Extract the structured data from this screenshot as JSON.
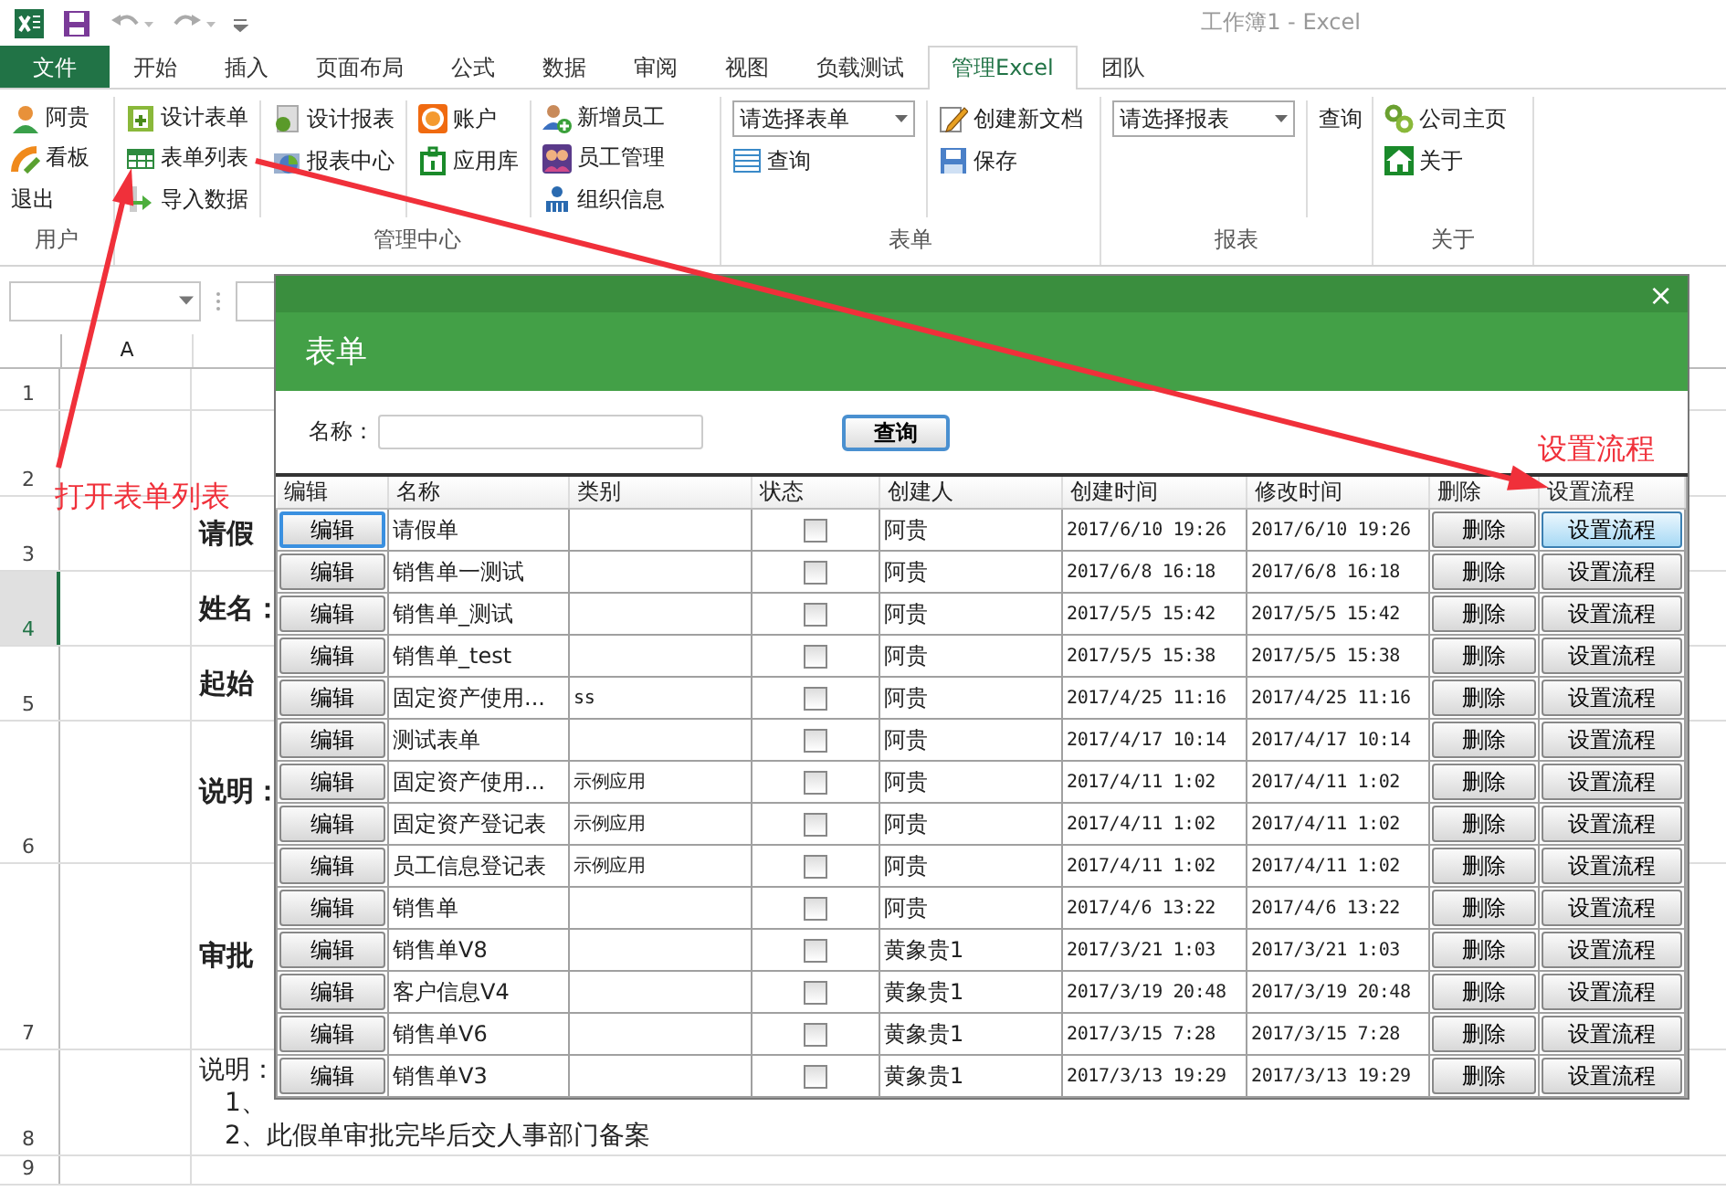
{
  "title_bar": {
    "title": "工作簿1 - Excel"
  },
  "tabs": [
    {
      "label": "文件",
      "kind": "file",
      "selected": false
    },
    {
      "label": "开始",
      "kind": "tab",
      "selected": false
    },
    {
      "label": "插入",
      "kind": "tab",
      "selected": false
    },
    {
      "label": "页面布局",
      "kind": "tab",
      "selected": false
    },
    {
      "label": "公式",
      "kind": "tab",
      "selected": false
    },
    {
      "label": "数据",
      "kind": "tab",
      "selected": false
    },
    {
      "label": "审阅",
      "kind": "tab",
      "selected": false
    },
    {
      "label": "视图",
      "kind": "tab",
      "selected": false
    },
    {
      "label": "负载测试",
      "kind": "tab",
      "selected": false
    },
    {
      "label": "管理Excel",
      "kind": "tab",
      "selected": true
    },
    {
      "label": "团队",
      "kind": "tab",
      "selected": false
    }
  ],
  "ribbon": {
    "groups": [
      {
        "label": "用户",
        "columns": [
          {
            "items": [
              {
                "kind": "button",
                "label": "阿贵"
              },
              {
                "kind": "button",
                "label": "看板"
              },
              {
                "kind": "text",
                "label": "退出"
              }
            ]
          }
        ]
      },
      {
        "label": "管理中心",
        "columns": [
          {
            "items": [
              {
                "kind": "button",
                "label": "设计表单"
              },
              {
                "kind": "button",
                "label": "表单列表"
              },
              {
                "kind": "button",
                "label": "导入数据"
              }
            ]
          },
          {
            "items": [
              {
                "kind": "button",
                "label": "设计报表"
              },
              {
                "kind": "button",
                "label": "报表中心"
              }
            ]
          },
          {
            "items": [
              {
                "kind": "button",
                "label": "账户"
              },
              {
                "kind": "button",
                "label": "应用库"
              }
            ]
          },
          {
            "items": [
              {
                "kind": "button",
                "label": "新增员工"
              },
              {
                "kind": "button",
                "label": "员工管理"
              },
              {
                "kind": "button",
                "label": "组织信息"
              }
            ]
          }
        ]
      },
      {
        "label": "表单",
        "columns": [
          {
            "items": [
              {
                "kind": "dropdown",
                "value": "请选择表单"
              },
              {
                "kind": "button",
                "label": "查询"
              }
            ]
          },
          {
            "items": [
              {
                "kind": "button",
                "label": "创建新文档"
              },
              {
                "kind": "button",
                "label": "保存"
              }
            ]
          }
        ]
      },
      {
        "label": "报表",
        "columns": [
          {
            "items": [
              {
                "kind": "dropdown",
                "value": "请选择报表"
              }
            ]
          },
          {
            "items": [
              {
                "kind": "text",
                "label": "查询"
              }
            ]
          }
        ]
      },
      {
        "label": "关于",
        "columns": [
          {
            "items": [
              {
                "kind": "button",
                "label": "公司主页"
              },
              {
                "kind": "button",
                "label": "关于"
              }
            ]
          }
        ]
      }
    ]
  },
  "sheet": {
    "column_headers": [
      "A"
    ],
    "rows": [
      {
        "number": "1",
        "selected": false
      },
      {
        "number": "2",
        "selected": false
      },
      {
        "number": "3",
        "selected": false,
        "lines": [
          {
            "kind": "label",
            "text": "请假"
          }
        ]
      },
      {
        "number": "4",
        "selected": true,
        "lines": [
          {
            "kind": "label",
            "text": "姓名："
          }
        ]
      },
      {
        "number": "5",
        "selected": false,
        "lines": [
          {
            "kind": "label",
            "text": "起始"
          }
        ]
      },
      {
        "number": "6",
        "selected": false,
        "lines": [
          {
            "kind": "label",
            "text": "说明："
          }
        ]
      },
      {
        "number": "7",
        "selected": false,
        "lines": [
          {
            "kind": "label",
            "text": "审批"
          }
        ]
      },
      {
        "number": "8",
        "selected": false,
        "lines": [
          {
            "kind": "note",
            "text": "说明："
          },
          {
            "kind": "list_item",
            "text": "1、"
          },
          {
            "kind": "list_item",
            "text": "2、此假单审批完毕后交人事部门备案"
          }
        ]
      },
      {
        "number": "9",
        "selected": false
      }
    ]
  },
  "dialog": {
    "close": "×",
    "title": "表单",
    "name_label": "名称：",
    "query_button": "查询",
    "columns": [
      "编辑",
      "名称",
      "类别",
      "状态",
      "创建人",
      "创建时间",
      "修改时间",
      "删除",
      "设置流程"
    ],
    "rows": [
      {
        "edit": "编辑",
        "name": "请假单",
        "category": "",
        "checked": false,
        "creator": "阿贵",
        "created": "2017/6/10 19:26",
        "modified": "2017/6/10 19:26",
        "delete": "删除",
        "flow": "设置流程",
        "selected": true
      },
      {
        "edit": "编辑",
        "name": "销售单一测试",
        "category": "",
        "checked": false,
        "creator": "阿贵",
        "created": "2017/6/8 16:18",
        "modified": "2017/6/8 16:18",
        "delete": "删除",
        "flow": "设置流程",
        "selected": false
      },
      {
        "edit": "编辑",
        "name": "销售单_测试",
        "category": "",
        "checked": false,
        "creator": "阿贵",
        "created": "2017/5/5 15:42",
        "modified": "2017/5/5 15:42",
        "delete": "删除",
        "flow": "设置流程",
        "selected": false
      },
      {
        "edit": "编辑",
        "name": "销售单_test",
        "category": "",
        "checked": false,
        "creator": "阿贵",
        "created": "2017/5/5 15:38",
        "modified": "2017/5/5 15:38",
        "delete": "删除",
        "flow": "设置流程",
        "selected": false
      },
      {
        "edit": "编辑",
        "name": "固定资产使用...",
        "category": "ss",
        "checked": false,
        "creator": "阿贵",
        "created": "2017/4/25 11:16",
        "modified": "2017/4/25 11:16",
        "delete": "删除",
        "flow": "设置流程",
        "selected": false
      },
      {
        "edit": "编辑",
        "name": "测试表单",
        "category": "",
        "checked": false,
        "creator": "阿贵",
        "created": "2017/4/17 10:14",
        "modified": "2017/4/17 10:14",
        "delete": "删除",
        "flow": "设置流程",
        "selected": false
      },
      {
        "edit": "编辑",
        "name": "固定资产使用...",
        "category": "示例应用",
        "checked": false,
        "creator": "阿贵",
        "created": "2017/4/11 1:02",
        "modified": "2017/4/11 1:02",
        "delete": "删除",
        "flow": "设置流程",
        "selected": false
      },
      {
        "edit": "编辑",
        "name": "固定资产登记表",
        "category": "示例应用",
        "checked": false,
        "creator": "阿贵",
        "created": "2017/4/11 1:02",
        "modified": "2017/4/11 1:02",
        "delete": "删除",
        "flow": "设置流程",
        "selected": false
      },
      {
        "edit": "编辑",
        "name": "员工信息登记表",
        "category": "示例应用",
        "checked": false,
        "creator": "阿贵",
        "created": "2017/4/11 1:02",
        "modified": "2017/4/11 1:02",
        "delete": "删除",
        "flow": "设置流程",
        "selected": false
      },
      {
        "edit": "编辑",
        "name": "销售单",
        "category": "",
        "checked": false,
        "creator": "阿贵",
        "created": "2017/4/6 13:22",
        "modified": "2017/4/6 13:22",
        "delete": "删除",
        "flow": "设置流程",
        "selected": false
      },
      {
        "edit": "编辑",
        "name": "销售单V8",
        "category": "",
        "checked": false,
        "creator": "黄象贵1",
        "created": "2017/3/21 1:03",
        "modified": "2017/3/21 1:03",
        "delete": "删除",
        "flow": "设置流程",
        "selected": false
      },
      {
        "edit": "编辑",
        "name": "客户信息V4",
        "category": "",
        "checked": false,
        "creator": "黄象贵1",
        "created": "2017/3/19 20:48",
        "modified": "2017/3/19 20:48",
        "delete": "删除",
        "flow": "设置流程",
        "selected": false
      },
      {
        "edit": "编辑",
        "name": "销售单V6",
        "category": "",
        "checked": false,
        "creator": "黄象贵1",
        "created": "2017/3/15 7:28",
        "modified": "2017/3/15 7:28",
        "delete": "删除",
        "flow": "设置流程",
        "selected": false
      },
      {
        "edit": "编辑",
        "name": "销售单V3",
        "category": "",
        "checked": false,
        "creator": "黄象贵1",
        "created": "2017/3/13 19:29",
        "modified": "2017/3/13 19:29",
        "delete": "删除",
        "flow": "设置流程",
        "selected": false
      }
    ]
  },
  "annotations": [
    {
      "text": "打开表单列表"
    },
    {
      "text": "设置流程"
    }
  ]
}
